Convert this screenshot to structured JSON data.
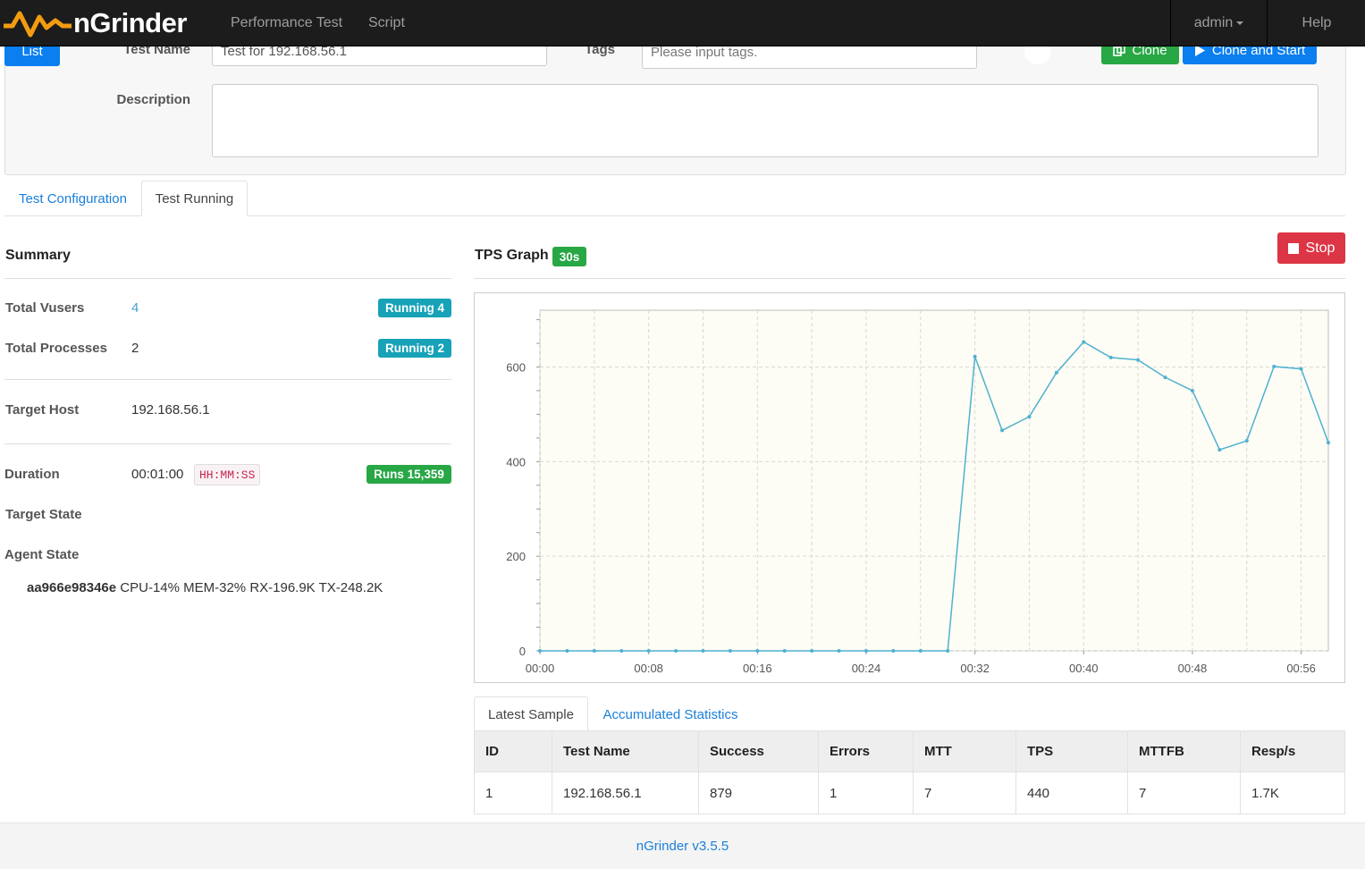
{
  "nav": {
    "brand": "nGrinder",
    "items": [
      "Performance Test",
      "Script"
    ],
    "user": "admin",
    "help": "Help"
  },
  "form": {
    "list_button": "List",
    "test_name_label": "Test Name",
    "test_name_value": "Test for 192.168.56.1",
    "tags_label": "Tags",
    "tags_placeholder": "Please input tags.",
    "description_label": "Description",
    "description_value": "",
    "clone_button": "Clone",
    "clone_start_button": "Clone and Start"
  },
  "tabs": {
    "config": "Test Configuration",
    "running": "Test Running"
  },
  "summary": {
    "title": "Summary",
    "total_vusers_label": "Total Vusers",
    "total_vusers_value": "4",
    "running_vusers_badge": "Running 4",
    "total_processes_label": "Total Processes",
    "total_processes_value": "2",
    "running_processes_badge": "Running 2",
    "target_host_label": "Target Host",
    "target_host_value": "192.168.56.1",
    "duration_label": "Duration",
    "duration_value": "00:01:00",
    "duration_format": "HH:MM:SS",
    "runs_badge": "Runs 15,359",
    "target_state_label": "Target State",
    "agent_state_label": "Agent State",
    "agent_id": "aa966e98346e",
    "agent_stats": "CPU-14% MEM-32% RX-196.9K TX-248.2K"
  },
  "graph": {
    "title": "TPS Graph",
    "interval_badge": "30s",
    "stop_button": "Stop"
  },
  "chart_data": {
    "type": "line",
    "title": "TPS Graph",
    "xlabel": "",
    "ylabel": "",
    "x_ticks": [
      "00:00",
      "00:08",
      "00:16",
      "00:24",
      "00:32",
      "00:40",
      "00:48",
      "00:56"
    ],
    "y_ticks": [
      0,
      200,
      400,
      600
    ],
    "xlim": [
      0,
      58
    ],
    "ylim": [
      0,
      720
    ],
    "grid": true,
    "series": [
      {
        "x": [
          0,
          2,
          4,
          6,
          8,
          10,
          12,
          14,
          16,
          18,
          20,
          22,
          24,
          26,
          28,
          30,
          32,
          34,
          36,
          38,
          40,
          42,
          44,
          46,
          48,
          50,
          52,
          54,
          56,
          58
        ],
        "values": [
          0,
          0,
          0,
          0,
          0,
          0,
          0,
          0,
          0,
          0,
          0,
          0,
          0,
          0,
          0,
          0,
          622,
          466,
          495,
          588,
          653,
          620,
          615,
          578,
          550,
          425,
          444,
          601,
          596,
          440
        ],
        "color": "#4fb1d0"
      }
    ]
  },
  "bottom_tabs": {
    "latest": "Latest Sample",
    "accumulated": "Accumulated Statistics"
  },
  "stats_table": {
    "headers": [
      "ID",
      "Test Name",
      "Success",
      "Errors",
      "MTT",
      "TPS",
      "MTTFB",
      "Resp/s"
    ],
    "rows": [
      [
        "1",
        "192.168.56.1",
        "879",
        "1",
        "7",
        "440",
        "7",
        "1.7K"
      ]
    ]
  },
  "footer": {
    "version": "nGrinder v3.5.5"
  },
  "colors": {
    "navbar": "#1c1c1c",
    "brand_orange": "#f39c12",
    "primary": "#0b7ef0",
    "success": "#28a745",
    "info": "#17a2b8",
    "danger": "#dc3545"
  }
}
